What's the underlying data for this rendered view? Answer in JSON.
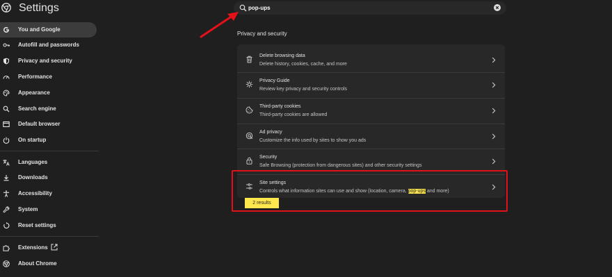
{
  "header": {
    "title": "Settings"
  },
  "search": {
    "query": "pop-ups",
    "icon": "search-icon",
    "clear_icon": "close-icon"
  },
  "sidebar": {
    "items": [
      {
        "label": "You and Google",
        "icon": "google-icon",
        "active": true
      },
      {
        "label": "Autofill and passwords",
        "icon": "key-icon"
      },
      {
        "label": "Privacy and security",
        "icon": "shield-icon"
      },
      {
        "label": "Performance",
        "icon": "speedometer-icon"
      },
      {
        "label": "Appearance",
        "icon": "palette-icon"
      },
      {
        "label": "Search engine",
        "icon": "search-icon"
      },
      {
        "label": "Default browser",
        "icon": "browser-icon"
      },
      {
        "label": "On startup",
        "icon": "power-icon"
      },
      {
        "label": "Languages",
        "icon": "translate-icon"
      },
      {
        "label": "Downloads",
        "icon": "download-icon"
      },
      {
        "label": "Accessibility",
        "icon": "accessibility-icon"
      },
      {
        "label": "System",
        "icon": "wrench-icon"
      },
      {
        "label": "Reset settings",
        "icon": "reset-icon"
      },
      {
        "label": "Extensions",
        "icon": "puzzle-icon",
        "external_icon": "external-link-icon"
      },
      {
        "label": "About Chrome",
        "icon": "chrome-icon"
      }
    ]
  },
  "main": {
    "section_title": "Privacy and security",
    "rows": [
      {
        "title": "Delete browsing data",
        "desc": "Delete history, cookies, cache, and more",
        "icon": "trash-icon"
      },
      {
        "title": "Privacy Guide",
        "desc": "Review key privacy and security controls",
        "icon": "privacy-guide-icon"
      },
      {
        "title": "Third-party cookies",
        "desc": "Third-party cookies are allowed",
        "icon": "cookie-icon"
      },
      {
        "title": "Ad privacy",
        "desc": "Customize the info used by sites to show you ads",
        "icon": "ad-privacy-icon"
      },
      {
        "title": "Security",
        "desc": "Safe Browsing (protection from dangerous sites) and other security settings",
        "icon": "lock-icon"
      },
      {
        "title": "Site settings",
        "desc_before": "Controls what information sites can use and show (location, camera, ",
        "desc_highlight": "pop-ups",
        "desc_after": " and more)",
        "icon": "sliders-icon"
      }
    ],
    "results_badge": "2 results"
  },
  "colors": {
    "background": "#1f1f1f",
    "card": "#282828",
    "active_nav": "#3c3c3c",
    "highlight": "#fde74c",
    "annotation_red": "#e3111a"
  }
}
